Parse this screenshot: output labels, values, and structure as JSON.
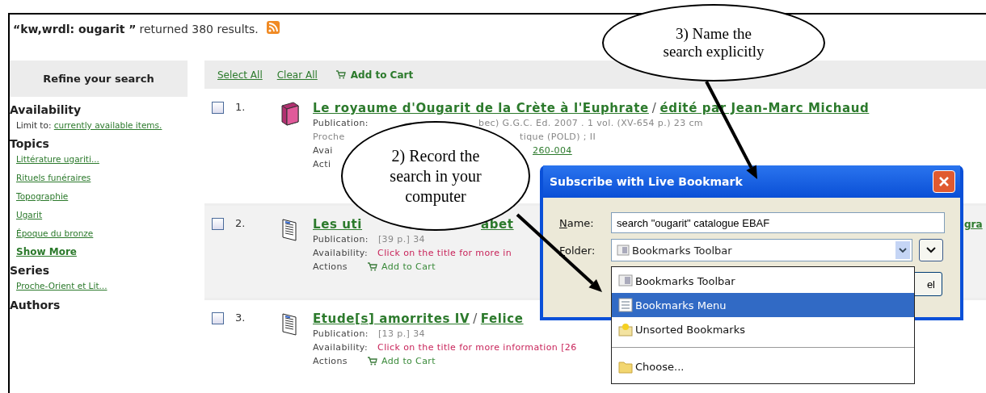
{
  "search_summary": {
    "query": "“kw,wrdl: ougarit ”",
    "text": "returned 380 results."
  },
  "sidebar": {
    "title": "Refine your search",
    "sections": [
      {
        "heading": "Availability",
        "lead": "Limit to:",
        "links": [
          "currently available items."
        ]
      },
      {
        "heading": "Topics",
        "links": [
          "Littérature ugariti...",
          "Rituels funéraires",
          "Topographie",
          "Ugarit",
          "Époque du bronze"
        ],
        "more": "Show More"
      },
      {
        "heading": "Series",
        "links": [
          "Proche-Orient et Lit..."
        ]
      },
      {
        "heading": "Authors"
      }
    ]
  },
  "toolbar": {
    "links": [
      "Select All",
      "Clear All"
    ],
    "cart": "Add to Cart"
  },
  "results": [
    {
      "number": "1.",
      "kind": "book",
      "checked": false,
      "shaded": false,
      "lines": [
        [
          {
            "kind": "title",
            "text": "Le royaume d'Ougarit de la Crète à l'Euphrate"
          },
          {
            "kind": "slash",
            "text": "/"
          },
          {
            "kind": "title",
            "text": "édité par Jean-Marc Michaud"
          }
        ],
        [
          {
            "kind": "label",
            "text": "Publication:"
          },
          {
            "kind": "muted",
            "text": "bec) G.G.C. Ed. 2007 . 1 vol. (XV-654 p.) 23 cm"
          }
        ],
        [
          {
            "kind": "muted",
            "text": "Proche"
          },
          {
            "kind": "muted",
            "text": "tique (POLD) ; II"
          }
        ],
        [
          {
            "kind": "label",
            "text": "Avai"
          },
          {
            "kind": "link",
            "text": "260-004"
          }
        ],
        [
          {
            "kind": "label",
            "text": "Acti"
          }
        ]
      ]
    },
    {
      "number": "2.",
      "kind": "article",
      "checked": false,
      "shaded": true,
      "lines": [
        [
          {
            "kind": "title",
            "text": "Les uti"
          },
          {
            "kind": "title",
            "text": "abet"
          },
          {
            "kind": "title",
            "text": "gra"
          }
        ],
        [
          {
            "kind": "label",
            "text": "Publication:"
          },
          {
            "kind": "muted",
            "text": "[39 p.] 34"
          }
        ],
        [
          {
            "kind": "label",
            "text": "Availability:"
          },
          {
            "kind": "red",
            "text": "Click on the title for more in"
          }
        ],
        [
          {
            "kind": "label",
            "text": "Actions"
          },
          {
            "kind": "cart",
            "text": "Add to Cart"
          }
        ]
      ]
    },
    {
      "number": "3.",
      "kind": "article",
      "checked": false,
      "shaded": false,
      "lines": [
        [
          {
            "kind": "title",
            "text": "Etude[s] amorrites IV"
          },
          {
            "kind": "slash",
            "text": "/"
          },
          {
            "kind": "title",
            "text": "Felice"
          }
        ],
        [
          {
            "kind": "label",
            "text": "Publication:"
          },
          {
            "kind": "muted",
            "text": "[13 p.] 34"
          }
        ],
        [
          {
            "kind": "label",
            "text": "Availability:"
          },
          {
            "kind": "red",
            "text": "Click on the title for more information [26"
          }
        ],
        [
          {
            "kind": "label",
            "text": "Actions"
          },
          {
            "kind": "cart",
            "text": "Add to Cart"
          }
        ]
      ]
    }
  ],
  "dialog": {
    "title": "Subscribe with Live Bookmark",
    "name_label": "Name:",
    "name_value": "search \"ougarit\" catalogue EBAF",
    "folder_label": "Folder:",
    "folder_value": "Bookmarks Toolbar",
    "button_fragment": "el",
    "menu": [
      {
        "label": "Bookmarks Toolbar",
        "kind": "toolbar",
        "selected": false
      },
      {
        "label": "Bookmarks Menu",
        "kind": "menu",
        "selected": true
      },
      {
        "label": "Unsorted Bookmarks",
        "kind": "unsorted",
        "selected": false
      },
      {
        "label": "Choose...",
        "kind": "choose",
        "selected": false
      }
    ]
  },
  "callouts": [
    {
      "kind": "record",
      "lines": [
        "2) Record the",
        "search in your",
        "computer"
      ]
    },
    {
      "kind": "name",
      "lines": [
        "3) Name the",
        "search explicitly"
      ]
    }
  ]
}
